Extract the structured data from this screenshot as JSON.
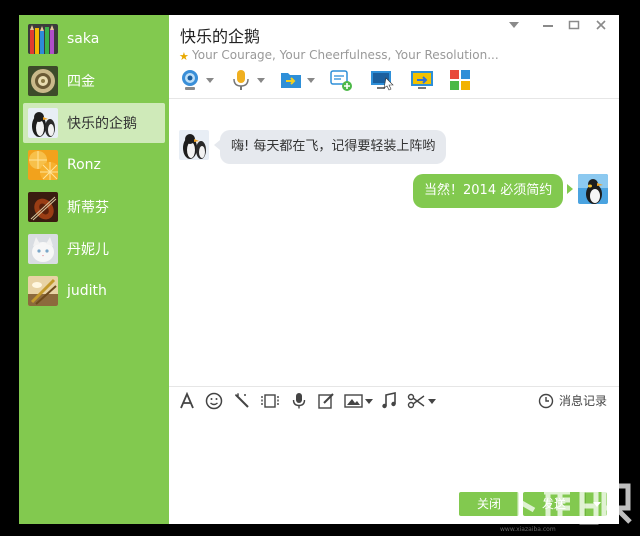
{
  "contacts": [
    {
      "name": "saka"
    },
    {
      "name": "四金"
    },
    {
      "name": "快乐的企鹅"
    },
    {
      "name": "Ronz"
    },
    {
      "name": "斯蒂芬"
    },
    {
      "name": "丹妮儿"
    },
    {
      "name": "judith"
    }
  ],
  "selected_contact_index": 2,
  "chat": {
    "title": "快乐的企鹅",
    "signature": "Your Courage, Your Cheerfulness, Your Resolution...",
    "messages": [
      {
        "direction": "incoming",
        "text": "嗨! 每天都在飞，记得要轻装上阵哟"
      },
      {
        "direction": "outgoing",
        "text": "当然！2014 必须简约"
      }
    ]
  },
  "window_controls": [
    "dropdown-icon",
    "minimize-icon",
    "maximize-icon",
    "close-icon"
  ],
  "chat_toolbar": [
    "video-call-icon",
    "voice-call-icon",
    "file-transfer-icon",
    "create-discussion-icon",
    "remote-desktop-icon",
    "screen-share-icon",
    "apps-icon"
  ],
  "editor_toolbar": [
    "font-icon",
    "emoji-icon",
    "magic-wand-icon",
    "video-clip-icon",
    "voice-message-icon",
    "edit-icon",
    "image-icon",
    "music-icon",
    "scissors-icon"
  ],
  "history_label": "消息记录",
  "buttons": {
    "close": "关闭",
    "send": "发送"
  },
  "watermark": {
    "logo": "下载吧",
    "url": "www.xiazaiba.com"
  },
  "colors": {
    "accent": "#82c94f",
    "selected_bg": "#cfeab9",
    "incoming_bubble": "#e6e9ee",
    "window_bg": "#000000"
  }
}
